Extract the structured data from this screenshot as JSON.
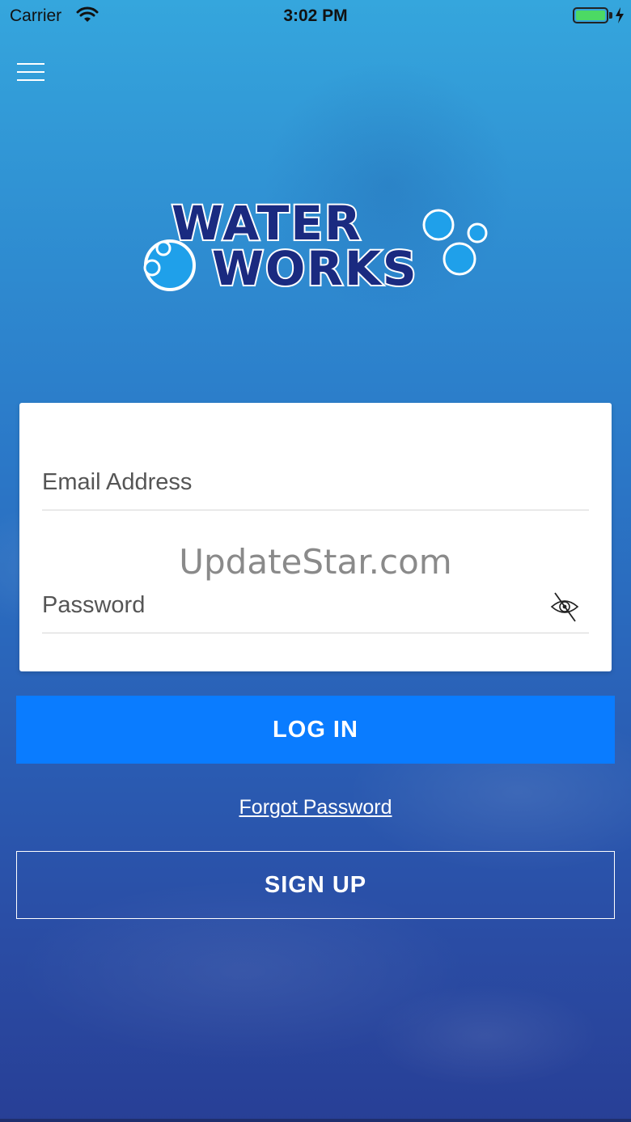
{
  "status_bar": {
    "carrier": "Carrier",
    "time": "3:02 PM",
    "battery_color": "#4cd964"
  },
  "logo": {
    "line1": "WATER",
    "line2": "WORKS"
  },
  "login": {
    "email_placeholder": "Email Address",
    "password_placeholder": "Password",
    "watermark": "UpdateStar.com",
    "login_label": "LOG IN",
    "forgot_label": "Forgot Password",
    "signup_label": "SIGN UP"
  },
  "colors": {
    "accent": "#0a7cff",
    "logo_navy": "#1a2a80",
    "logo_blue": "#2aa3f0"
  },
  "icons": {
    "menu": "hamburger-menu-icon",
    "password_toggle": "eye-slash-icon",
    "wifi": "wifi-icon"
  }
}
